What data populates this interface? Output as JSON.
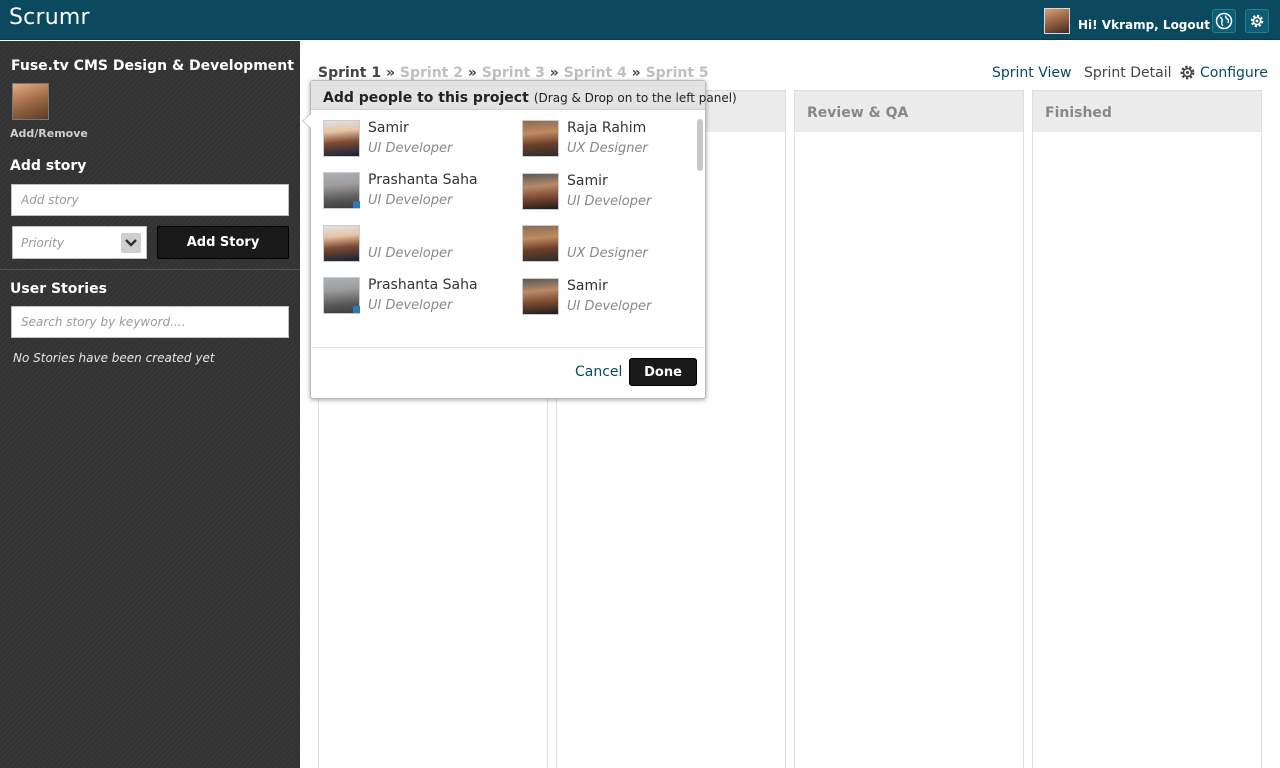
{
  "app": {
    "brand": "Scrumr"
  },
  "header": {
    "greeting": "Hi! Vkramp, Logout"
  },
  "sidebar": {
    "project_title": "Fuse.tv CMS Design & Development",
    "add_remove_label": "Add/Remove",
    "add_story_title": "Add story",
    "add_story_placeholder": "Add story",
    "priority_placeholder": "Priority",
    "add_story_button": "Add Story",
    "user_stories_title": "User Stories",
    "search_placeholder": "Search story by keyword....",
    "empty_message": "No Stories have been created yet"
  },
  "breadcrumb": {
    "current": "Sprint 1",
    "separator": "»",
    "others": [
      "Sprint 2",
      "Sprint 3",
      "Sprint 4",
      "Sprint 5"
    ]
  },
  "views": {
    "sprint_view": "Sprint View",
    "sprint_detail": "Sprint Detail",
    "configure": "Configure"
  },
  "columns": [
    "Review & QA",
    "Finished"
  ],
  "popup": {
    "title": "Add people to this project",
    "subtitle": "(Drag & Drop on to the left panel)",
    "people": [
      {
        "name": "Samir",
        "role": "UI Developer"
      },
      {
        "name": "Raja Rahim",
        "role": "UX Designer"
      },
      {
        "name": "Prashanta Saha",
        "role": "UI Developer"
      },
      {
        "name": "Samir",
        "role": "UI Developer"
      },
      {
        "name": "",
        "role": "UI Developer"
      },
      {
        "name": "",
        "role": "UX Designer"
      },
      {
        "name": "Prashanta Saha",
        "role": "UI Developer"
      },
      {
        "name": "Samir",
        "role": "UI Developer"
      }
    ],
    "cancel": "Cancel",
    "done": "Done"
  },
  "colors": {
    "topbar": "#0b4a5e",
    "sidebar": "#333333",
    "accent_link": "#0b4a5e"
  }
}
